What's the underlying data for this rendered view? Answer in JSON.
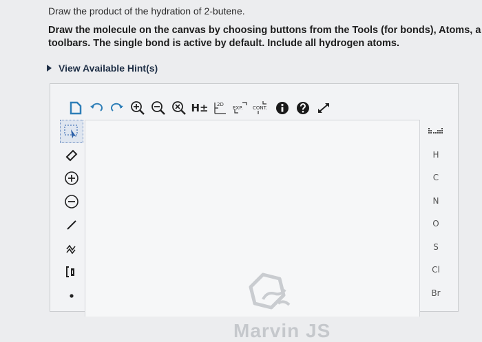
{
  "question": {
    "prompt": "Draw the product of the hydration of 2-butene.",
    "instruction_line1": "Draw the molecule on the canvas by choosing buttons from the Tools (for bonds), Atoms, a",
    "instruction_line2": "toolbars. The single bond is active by default. Include all hydrogen atoms.",
    "hint_label": "View Available Hint(s)"
  },
  "toolbar": {
    "h_label": "H±",
    "view2d_label": "2D",
    "expand_label": "EXP.",
    "contract_label": "CONT."
  },
  "atoms": [
    "H",
    "C",
    "N",
    "O",
    "S",
    "Cl",
    "Br"
  ],
  "canvas": {
    "watermark": "Marvin JS"
  }
}
